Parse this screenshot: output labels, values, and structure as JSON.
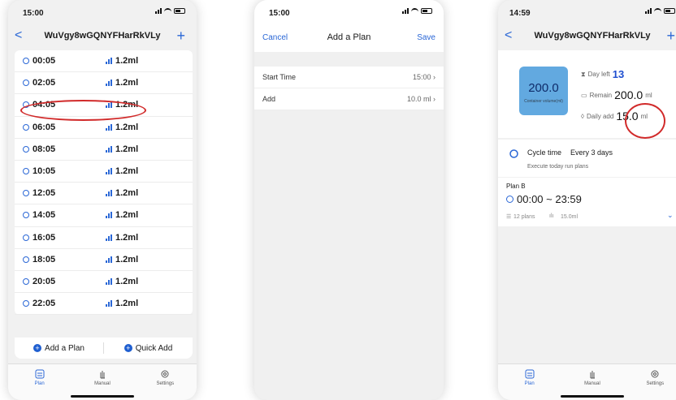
{
  "phone1": {
    "status_time": "15:00",
    "nav_title": "WuVgy8wGQNYFHarRkVLy",
    "back_glyph": "<",
    "add_glyph": "+",
    "rows": [
      {
        "time": "00:05",
        "amount": "1.2ml"
      },
      {
        "time": "02:05",
        "amount": "1.2ml"
      },
      {
        "time": "04:05",
        "amount": "1.2ml"
      },
      {
        "time": "06:05",
        "amount": "1.2ml"
      },
      {
        "time": "08:05",
        "amount": "1.2ml"
      },
      {
        "time": "10:05",
        "amount": "1.2ml"
      },
      {
        "time": "12:05",
        "amount": "1.2ml"
      },
      {
        "time": "14:05",
        "amount": "1.2ml"
      },
      {
        "time": "16:05",
        "amount": "1.2ml"
      },
      {
        "time": "18:05",
        "amount": "1.2ml"
      },
      {
        "time": "20:05",
        "amount": "1.2ml"
      },
      {
        "time": "22:05",
        "amount": "1.2ml"
      }
    ],
    "add_plan_label": "Add a Plan",
    "quick_add_label": "Quick Add",
    "tabs": [
      "Plan",
      "Manual",
      "Settings"
    ]
  },
  "phone2": {
    "status_time": "15:00",
    "cancel_label": "Cancel",
    "title": "Add a Plan",
    "save_label": "Save",
    "start_time_label": "Start Time",
    "start_time_value": "15:00",
    "add_label": "Add",
    "add_value": "10.0 ml"
  },
  "phone3": {
    "status_time": "14:59",
    "nav_title": "WuVgy8wGQNYFHarRkVLy",
    "back_glyph": "<",
    "add_glyph": "+",
    "tank_value": "200.0",
    "tank_caption": "Container volume(ml)",
    "day_left_label": "Day left",
    "day_left_value": "13",
    "remain_label": "Remain",
    "remain_value": "200.0",
    "remain_unit": "ml",
    "daily_label": "Daily add",
    "daily_value": "15.0",
    "daily_unit": "ml",
    "cycle_label": "Cycle time",
    "cycle_value": "Every 3 days",
    "cycle_sub": "Execute today run plans",
    "cycle_chevron": ">",
    "plan_name": "Plan B",
    "plan_range": "00:00 ~ 23:59",
    "plans_count": "12 plans",
    "plans_amount": "15.0ml",
    "tabs": [
      "Plan",
      "Manual",
      "Settings"
    ]
  },
  "colors": {
    "accent": "#2a67d6",
    "highlight_circle": "#d12a2a",
    "tank": "#62a9e0"
  }
}
